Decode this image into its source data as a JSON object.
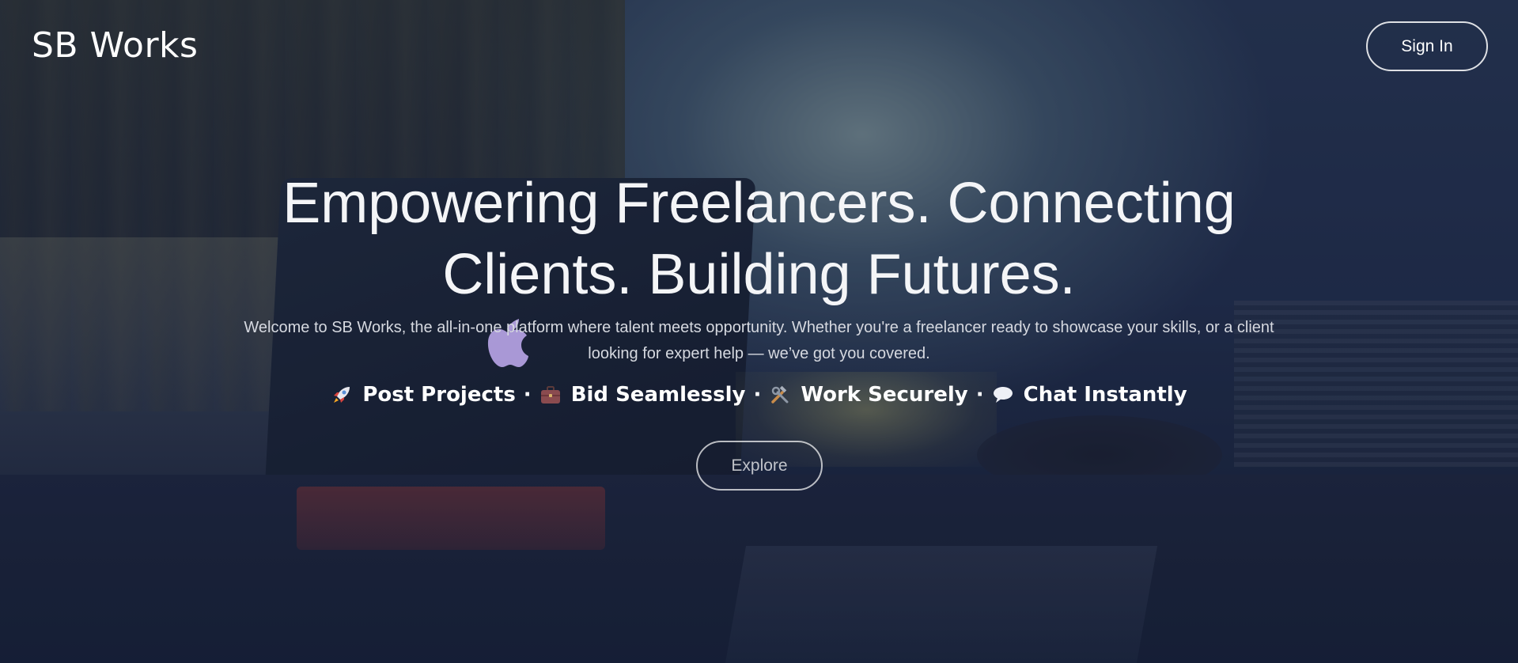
{
  "header": {
    "brand": "SB Works",
    "signin_label": "Sign In"
  },
  "hero": {
    "headline": "Empowering Freelancers. Connecting Clients. Building Futures.",
    "subtext": "Welcome to SB Works, the all-in-one platform where talent meets opportunity. Whether you're a freelancer ready to showcase your skills, or a client looking for expert help — we’ve got you covered.",
    "features": [
      {
        "icon": "rocket-icon",
        "label": "Post Projects"
      },
      {
        "icon": "briefcase-icon",
        "label": "Bid Seamlessly"
      },
      {
        "icon": "tools-icon",
        "label": "Work Securely"
      },
      {
        "icon": "speech-bubble-icon",
        "label": "Chat Instantly"
      }
    ],
    "separator": "·",
    "explore_label": "Explore"
  },
  "colors": {
    "text": "#ffffff",
    "background_overlay": "#1b2640"
  }
}
